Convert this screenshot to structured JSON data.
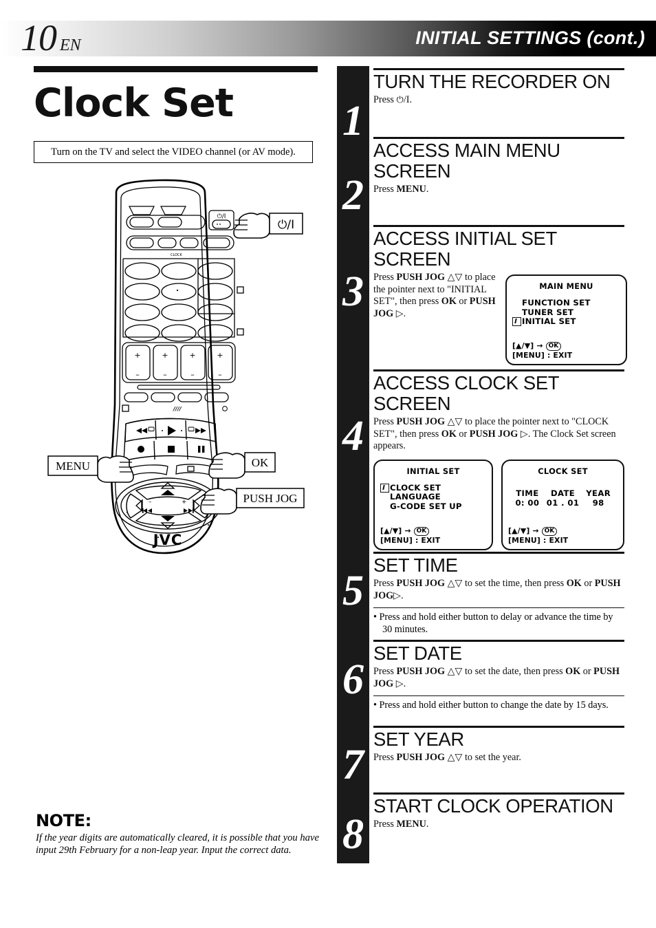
{
  "header": {
    "page_number": "10",
    "language_code": "EN",
    "section_title": "INITIAL SETTINGS (cont.)"
  },
  "left": {
    "title": "Clock Set",
    "intro": "Turn on the TV and select the VIDEO channel (or AV mode).",
    "note_heading": "NOTE:",
    "note_body": "If the year digits are automatically cleared, it is possible that you have input 29th February for a non-leap year. Input the correct data."
  },
  "remote": {
    "brand": "JVC",
    "callouts": {
      "power": "⏻/I",
      "menu": "MENU",
      "ok": "OK",
      "push_jog": "PUSH JOG"
    }
  },
  "steps": [
    {
      "number": "1",
      "heading": "TURN THE RECORDER ON",
      "body": "Press ⏻/I."
    },
    {
      "number": "2",
      "heading": "ACCESS MAIN MENU SCREEN",
      "body": "Press MENU."
    },
    {
      "number": "3",
      "heading": "ACCESS INITIAL SET SCREEN",
      "body": "Press PUSH JOG △▽ to place the pointer next to \"INITIAL SET\", then press OK or PUSH JOG ▷."
    },
    {
      "number": "4",
      "heading": "ACCESS CLOCK SET SCREEN",
      "body": "Press PUSH JOG △▽ to place the pointer next  to \"CLOCK SET\", then press OK or PUSH JOG ▷. The Clock Set screen appears."
    },
    {
      "number": "5",
      "heading": "SET TIME",
      "body": "Press PUSH JOG △▽ to set the time, then press OK or PUSH JOG ▷.",
      "bullet": "Press and hold either button to delay or advance the time by 30 minutes."
    },
    {
      "number": "6",
      "heading": "SET DATE",
      "body": "Press PUSH JOG △▽ to set the date, then press OK or PUSH JOG ▷.",
      "bullet": "Press and hold either button to change the date by 15 days."
    },
    {
      "number": "7",
      "heading": "SET YEAR",
      "body": "Press PUSH JOG △▽ to set the year."
    },
    {
      "number": "8",
      "heading": "START CLOCK OPERATION",
      "body": "Press MENU."
    }
  ],
  "osd_screens": {
    "main_menu": {
      "title": "MAIN MENU",
      "items": [
        "FUNCTION SET",
        "TUNER SET",
        "INITIAL SET"
      ],
      "pointer_index": 2,
      "footer_line1": "[▲/▼] →",
      "footer_ok": "OK",
      "footer_line2": "[MENU] : EXIT"
    },
    "initial_set": {
      "title": "INITIAL SET",
      "items": [
        "CLOCK SET",
        "LANGUAGE",
        "G-CODE SET UP"
      ],
      "pointer_index": 0,
      "footer_line1": "[▲/▼] →",
      "footer_ok": "OK",
      "footer_line2": "[MENU] : EXIT"
    },
    "clock_set": {
      "title": "CLOCK SET",
      "columns": [
        {
          "label": "TIME",
          "value": "0: 00"
        },
        {
          "label": "DATE",
          "value": "01 . 01"
        },
        {
          "label": "YEAR",
          "value": "98"
        }
      ],
      "footer_line1": "[▲/▼] →",
      "footer_ok": "OK",
      "footer_line2": "[MENU] : EXIT"
    }
  },
  "colors": {
    "ink": "#111111",
    "bar": "#1a1a1a",
    "paper": "#ffffff"
  }
}
